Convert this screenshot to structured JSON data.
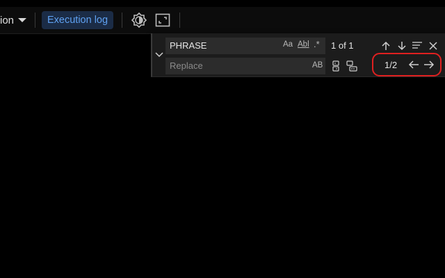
{
  "toolbar": {
    "dropdown_label": "ion",
    "execution_log_label": "Execution log",
    "execution_log_color": "#5fa1f1",
    "icons": [
      "chevron-down-icon",
      "brightness-icon",
      "expand-icon"
    ]
  },
  "find_widget": {
    "find_value": "PHRASE",
    "replace_placeholder": "Replace",
    "match_case_label": "Aa",
    "whole_word_label": "Abl",
    "regex_label": ".*",
    "preserve_case_label": "AB",
    "match_count": "1 of 1",
    "nav_count": "1/2",
    "highlight_color": "#e02020",
    "icons": [
      "chevron-down-icon",
      "arrow-up-icon",
      "arrow-down-icon",
      "find-in-selection-icon",
      "close-icon",
      "replace-one-icon",
      "replace-all-icon",
      "arrow-left-icon",
      "arrow-right-icon"
    ]
  }
}
